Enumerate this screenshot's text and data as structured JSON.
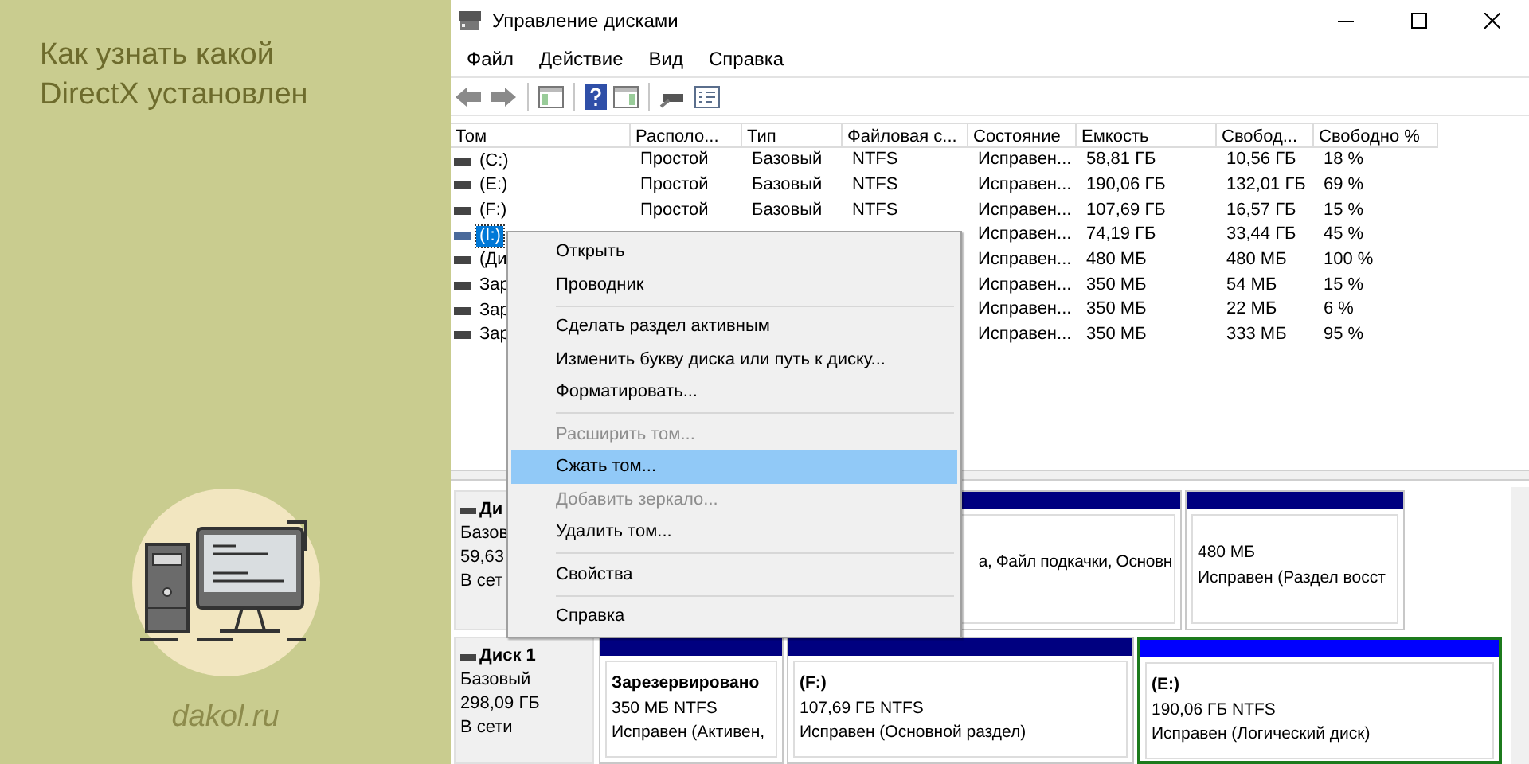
{
  "banner": {
    "title_lines": [
      "Как узнать какой",
      "DirectX установлен"
    ],
    "site": "dakol.ru"
  },
  "window": {
    "title": "Управление дисками"
  },
  "menu_bar": [
    "Файл",
    "Действие",
    "Вид",
    "Справка"
  ],
  "table": {
    "columns": [
      "Том",
      "Располо...",
      "Тип",
      "Файловая с...",
      "Состояние",
      "Емкость",
      "Свобод...",
      "Свободно %"
    ],
    "rows": [
      {
        "volume": "(C:)",
        "layout": "Простой",
        "type": "Базовый",
        "file_system": "NTFS",
        "status": "Исправен...",
        "capacity": "58,81 ГБ",
        "free": "10,56 ГБ",
        "free_percent": "18 %",
        "selected": false
      },
      {
        "volume": "(E:)",
        "layout": "Простой",
        "type": "Базовый",
        "file_system": "NTFS",
        "status": "Исправен...",
        "capacity": "190,06 ГБ",
        "free": "132,01 ГБ",
        "free_percent": "69 %",
        "selected": false
      },
      {
        "volume": "(F:)",
        "layout": "Простой",
        "type": "Базовый",
        "file_system": "NTFS",
        "status": "Исправен...",
        "capacity": "107,69 ГБ",
        "free": "16,57 ГБ",
        "free_percent": "15 %",
        "selected": false
      },
      {
        "volume": "(I:)",
        "status": "Исправен...",
        "capacity": "74,19 ГБ",
        "free": "33,44 ГБ",
        "free_percent": "45 %",
        "selected": true
      },
      {
        "volume": "(Ди",
        "status": "Исправен...",
        "capacity": "480 МБ",
        "free": "480 МБ",
        "free_percent": "100 %",
        "selected": false
      },
      {
        "volume": "Зар",
        "status": "Исправен...",
        "capacity": "350 МБ",
        "free": "54 МБ",
        "free_percent": "15 %",
        "selected": false
      },
      {
        "volume": "Зар",
        "status": "Исправен...",
        "capacity": "350 МБ",
        "free": "22 МБ",
        "free_percent": "6 %",
        "selected": false
      },
      {
        "volume": "Зар",
        "status": "Исправен...",
        "capacity": "350 МБ",
        "free": "333 МБ",
        "free_percent": "95 %",
        "selected": false
      }
    ]
  },
  "disks": [
    {
      "name": "Ди",
      "type": "Базов",
      "size": "59,63",
      "state": "В сет",
      "partitions": [
        {
          "kind": "primary",
          "selected": false,
          "lines": [
            "а, Файл подкачки, Основн"
          ]
        },
        {
          "kind": "primary",
          "selected": false,
          "lines": [
            "480 МБ",
            "Исправен (Раздел восст"
          ]
        }
      ]
    },
    {
      "name": "Диск 1",
      "type": "Базовый",
      "size": "298,09 ГБ",
      "state": "В сети",
      "partitions": [
        {
          "kind": "primary",
          "selected": false,
          "label": "Зарезервировано",
          "lines": [
            "350 МБ NTFS",
            "Исправен (Активен,"
          ]
        },
        {
          "kind": "primary",
          "selected": false,
          "label": "(F:)",
          "lines": [
            "107,69 ГБ NTFS",
            "Исправен (Основной раздел)"
          ]
        },
        {
          "kind": "logical",
          "selected": true,
          "label": "(E:)",
          "lines": [
            "190,06 ГБ NTFS",
            "Исправен (Логический диск)"
          ]
        }
      ]
    }
  ],
  "context_menu": [
    {
      "kind": "item",
      "label": "Открыть",
      "disabled": false,
      "selected": false
    },
    {
      "kind": "item",
      "label": "Проводник",
      "disabled": false,
      "selected": false
    },
    {
      "kind": "separator"
    },
    {
      "kind": "item",
      "label": "Сделать раздел активным",
      "disabled": false,
      "selected": false
    },
    {
      "kind": "item",
      "label": "Изменить букву диска или путь к диску...",
      "disabled": false,
      "selected": false
    },
    {
      "kind": "item",
      "label": "Форматировать...",
      "disabled": false,
      "selected": false
    },
    {
      "kind": "separator"
    },
    {
      "kind": "item",
      "label": "Расширить том...",
      "disabled": true,
      "selected": false
    },
    {
      "kind": "item",
      "label": "Сжать том...",
      "disabled": false,
      "selected": true
    },
    {
      "kind": "item",
      "label": "Добавить зеркало...",
      "disabled": true,
      "selected": false
    },
    {
      "kind": "item",
      "label": "Удалить том...",
      "disabled": false,
      "selected": false
    },
    {
      "kind": "separator"
    },
    {
      "kind": "item",
      "label": "Свойства",
      "disabled": false,
      "selected": false
    },
    {
      "kind": "separator"
    },
    {
      "kind": "item",
      "label": "Справка",
      "disabled": false,
      "selected": false
    }
  ]
}
